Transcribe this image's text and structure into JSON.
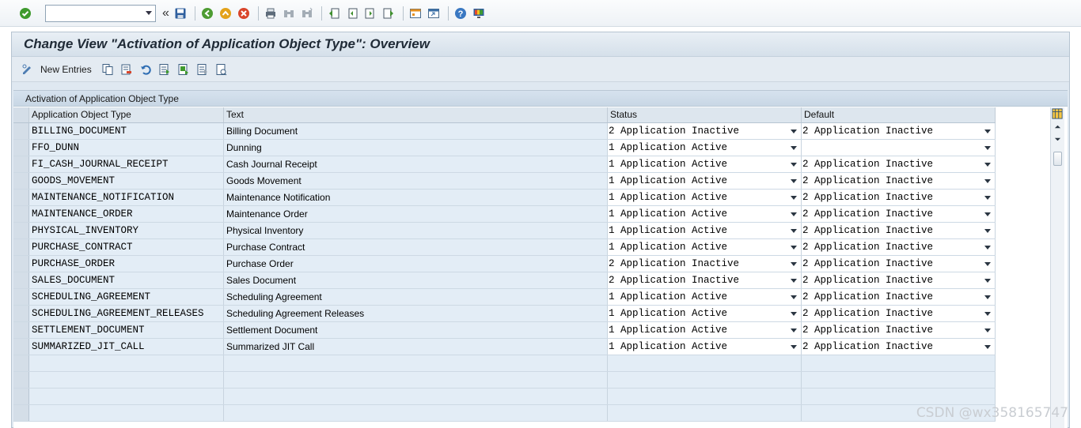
{
  "system_toolbar": {
    "command_field_value": "",
    "icons": [
      "enter-icon",
      "save-icon",
      "back-icon",
      "exit-icon",
      "cancel-icon",
      "print-icon",
      "find-icon",
      "find-next-icon",
      "first-page-icon",
      "previous-page-icon",
      "next-page-icon",
      "last-page-icon",
      "create-session-icon",
      "shortcut-icon",
      "help-icon",
      "customize-layout-icon"
    ]
  },
  "title": "Change View \"Activation of Application Object Type\": Overview",
  "app_toolbar": {
    "new_entries_label": "New Entries"
  },
  "table": {
    "section_title": "Activation of Application Object Type",
    "columns": [
      "Application Object Type",
      "Text",
      "Status",
      "Default"
    ],
    "rows": [
      {
        "type": "BILLING_DOCUMENT",
        "text": "Billing Document",
        "status": "2 Application Inactive",
        "default": "2 Application Inactive"
      },
      {
        "type": "FFO_DUNN",
        "text": "Dunning",
        "status": "1 Application Active",
        "default": ""
      },
      {
        "type": "FI_CASH_JOURNAL_RECEIPT",
        "text": "Cash Journal Receipt",
        "status": "1 Application Active",
        "default": "2 Application Inactive"
      },
      {
        "type": "GOODS_MOVEMENT",
        "text": "Goods Movement",
        "status": "1 Application Active",
        "default": "2 Application Inactive"
      },
      {
        "type": "MAINTENANCE_NOTIFICATION",
        "text": "Maintenance Notification",
        "status": "1 Application Active",
        "default": "2 Application Inactive"
      },
      {
        "type": "MAINTENANCE_ORDER",
        "text": "Maintenance Order",
        "status": "1 Application Active",
        "default": "2 Application Inactive"
      },
      {
        "type": "PHYSICAL_INVENTORY",
        "text": "Physical Inventory",
        "status": "1 Application Active",
        "default": "2 Application Inactive"
      },
      {
        "type": "PURCHASE_CONTRACT",
        "text": "Purchase Contract",
        "status": "1 Application Active",
        "default": "2 Application Inactive"
      },
      {
        "type": "PURCHASE_ORDER",
        "text": "Purchase Order",
        "status": "2 Application Inactive",
        "default": "2 Application Inactive"
      },
      {
        "type": "SALES_DOCUMENT",
        "text": "Sales Document",
        "status": "2 Application Inactive",
        "default": "2 Application Inactive"
      },
      {
        "type": "SCHEDULING_AGREEMENT",
        "text": "Scheduling Agreement",
        "status": "1 Application Active",
        "default": "2 Application Inactive"
      },
      {
        "type": "SCHEDULING_AGREEMENT_RELEASES",
        "text": "Scheduling Agreement Releases",
        "status": "1 Application Active",
        "default": "2 Application Inactive"
      },
      {
        "type": "SETTLEMENT_DOCUMENT",
        "text": "Settlement Document",
        "status": "1 Application Active",
        "default": "2 Application Inactive"
      },
      {
        "type": "SUMMARIZED_JIT_CALL",
        "text": "Summarized JIT Call",
        "status": "1 Application Active",
        "default": "2 Application Inactive"
      }
    ]
  },
  "watermark": "CSDN @wx358165747",
  "colors": {
    "frame_bg": "#dfe8f1",
    "cell_bg": "#e3edf6",
    "input_bg": "#ffffff"
  }
}
